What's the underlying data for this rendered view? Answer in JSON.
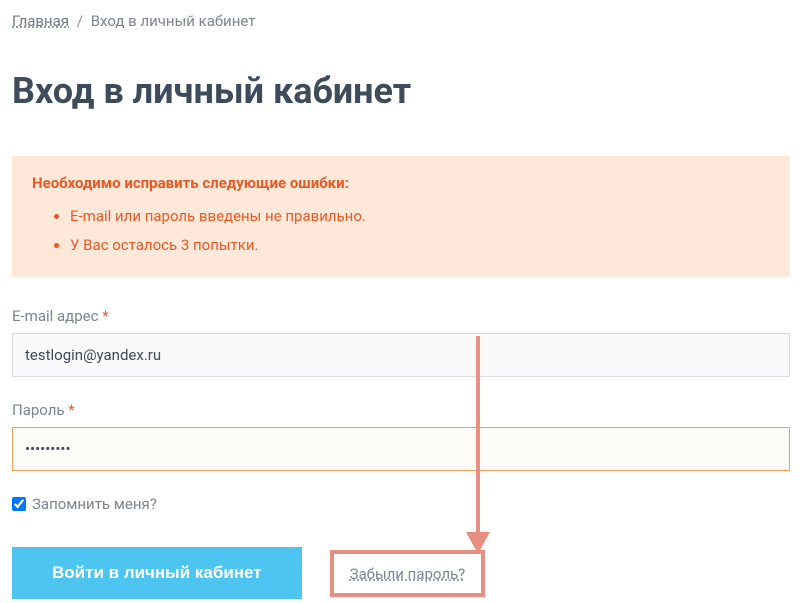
{
  "breadcrumb": {
    "home": "Главная",
    "current": "Вход в личный кабинет"
  },
  "page_title": "Вход в личный кабинет",
  "error_box": {
    "heading": "Необходимо исправить следующие ошибки:",
    "items": [
      "E-mail или пароль введены не правильно.",
      "У Вас осталось 3 попытки."
    ]
  },
  "form": {
    "email_label": "E-mail адрес",
    "email_value": "testlogin@yandex.ru",
    "password_label": "Пароль",
    "password_value": "•••••••••",
    "remember_label": "Запомнить меня?",
    "submit_label": "Войти в личный кабинет",
    "forgot_label": "Забыли пароль?",
    "required_star": "*"
  }
}
